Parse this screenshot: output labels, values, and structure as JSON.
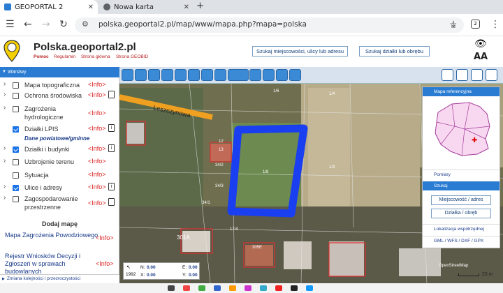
{
  "browser": {
    "tabs": [
      {
        "label": "GEOPORTAL 2",
        "active": true
      },
      {
        "label": "Nowa karta",
        "active": false
      }
    ],
    "url": "polska.geoportal2.pl/map/www/mapa.php?mapa=polska",
    "new_tab": "+",
    "close_glyph": "✕"
  },
  "header": {
    "title": "Polska.geoportal2.pl",
    "links": [
      "Pomoc",
      "Regulamin",
      "Strona główna",
      "Strona GEOBID"
    ],
    "search_address_btn": "Szukaj miejscowości, ulicy lub adresu",
    "search_parcel_btn": "Szukaj działki lub obrębu",
    "font_size_label": "AA"
  },
  "layers": {
    "header": "Warstwy",
    "info_label": "<Info>",
    "items": [
      {
        "name": "Mapa topograficzna",
        "chevron": true,
        "checked": false,
        "icon": "none"
      },
      {
        "name": "Ochrona środowiska",
        "chevron": true,
        "checked": false,
        "icon": "doc"
      },
      {
        "name": "Zagrożenia hydrologiczne",
        "chevron": true,
        "checked": false,
        "icon": "none"
      },
      {
        "name": "Działki LPIS",
        "chevron": false,
        "checked": true,
        "icon": "info"
      },
      {
        "name": "Działki i budynki",
        "chevron": true,
        "checked": true,
        "icon": "info"
      },
      {
        "name": "Uzbrojenie terenu",
        "chevron": true,
        "checked": false,
        "icon": "none"
      },
      {
        "name": "Sytuacja",
        "chevron": false,
        "checked": false,
        "icon": "none"
      },
      {
        "name": "Ulice i adresy",
        "chevron": true,
        "checked": true,
        "icon": "info"
      },
      {
        "name": "Zagospodarowanie przestrzenne",
        "chevron": true,
        "checked": false,
        "icon": "doc"
      }
    ],
    "local_data_label": "Dane powiatowe/gminne",
    "add_map_title": "Dodaj mapę",
    "add_maps": [
      {
        "name": "Mapa Zagrożenia Powodziowego"
      },
      {
        "name": "Rejestr Wniosków Decyzji i Zgłoszeń w sprawach budowlanych"
      }
    ],
    "order_link": "Zmiana kolejności i przezroczystości"
  },
  "map": {
    "street_label": "Leszczynowa",
    "parcel_labels": [
      "1/6",
      "1/8",
      "1/3",
      "1/4",
      "12",
      "13",
      "34/2",
      "34/3",
      "17/4",
      "305E",
      "301A",
      "34/1"
    ],
    "highlight_color": "#1a3ff0",
    "street_color": "#f0a020"
  },
  "right_panel": {
    "reference_map": "Mapa referencyjna",
    "measurements": "Pomiary",
    "search": "Szukaj",
    "btn_place": "Miejscowość / adres",
    "btn_parcel": "Działka / obręb",
    "coord_location": "Lokalizacja współrzędnej",
    "formats": "GML / WFS / DXF / GPX"
  },
  "coords": {
    "n_label": "N:",
    "n_value": "0.00",
    "e_label": "E:",
    "e_value": "0.00",
    "x_label": "X:",
    "x_value": "0.00",
    "y_label": "Y:",
    "y_value": "0.00",
    "epsg": "1992"
  },
  "scale": {
    "label": "20 m",
    "attribution": "OpenStreetMap"
  }
}
